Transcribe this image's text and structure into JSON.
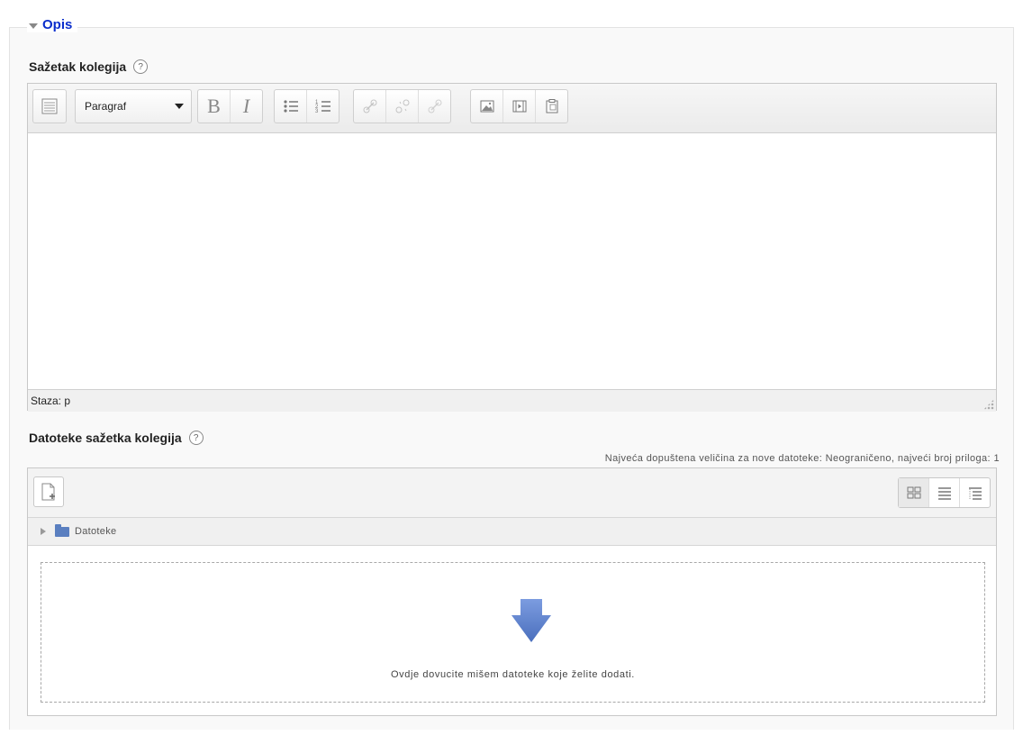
{
  "section": {
    "title": "Opis"
  },
  "summary": {
    "label": "Sažetak kolegija",
    "format_select": "Paragraf",
    "statusbar": "Staza: p",
    "toolbar_icons": [
      "toggle-toolbar-icon",
      "bold-icon",
      "italic-icon",
      "unordered-list-icon",
      "ordered-list-icon",
      "link-icon",
      "unlink-icon",
      "anchor-icon",
      "image-icon",
      "media-icon",
      "paste-icon"
    ]
  },
  "files": {
    "label": "Datoteke sažetka kolegija",
    "max_info": "Najveća dopuštena veličina za nove datoteke: Neograničeno, najveći broj priloga: 1",
    "path_folder": "Datoteke",
    "drop_text": "Ovdje dovucite mišem datoteke koje želite dodati.",
    "view_icons": [
      "icons-view-icon",
      "list-view-icon",
      "tree-view-icon"
    ]
  },
  "colors": {
    "legend": "#0a2ecc",
    "drop_arrow": "#5b7fc7"
  }
}
